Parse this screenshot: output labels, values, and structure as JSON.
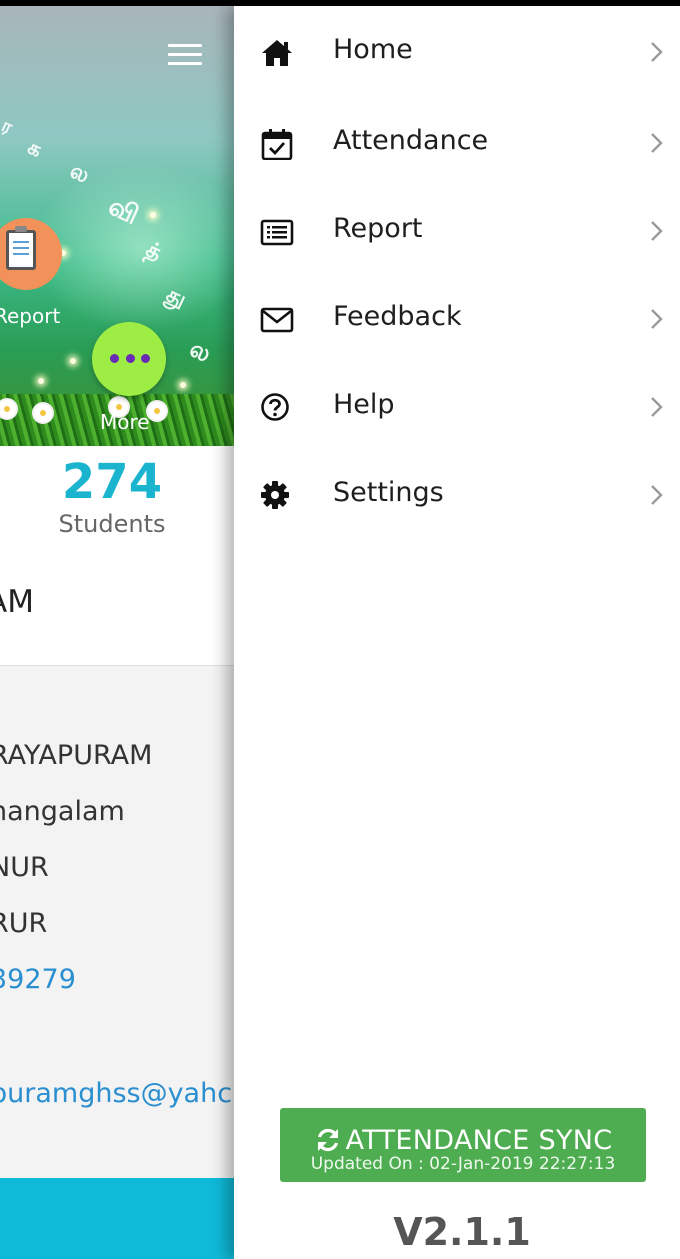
{
  "background_app": {
    "report_label": "Report",
    "more_label": "More",
    "students_count": "274",
    "students_label": "Students",
    "school_name_fragment": "AM",
    "info_lines": [
      "RAYAPURAM",
      "nangalam",
      "NUR",
      "RUR",
      "39279",
      "puramghss@yahc"
    ]
  },
  "drawer": {
    "items": [
      {
        "label": "Home",
        "icon": "home-icon"
      },
      {
        "label": "Attendance",
        "icon": "calendar-check-icon"
      },
      {
        "label": "Report",
        "icon": "list-icon"
      },
      {
        "label": "Feedback",
        "icon": "envelope-icon"
      },
      {
        "label": "Help",
        "icon": "question-circle-icon"
      },
      {
        "label": "Settings",
        "icon": "gear-icon"
      }
    ],
    "sync_button": {
      "title": "ATTENDANCE SYNC",
      "updated": "Updated On : 02-Jan-2019 22:27:13"
    },
    "version": "V2.1.1"
  },
  "colors": {
    "accent": "#1ab4cf",
    "sync_green": "#4ead50",
    "more_green": "#9ded45",
    "report_orange": "#f3915a",
    "bottom_bar": "#0fbad9"
  }
}
